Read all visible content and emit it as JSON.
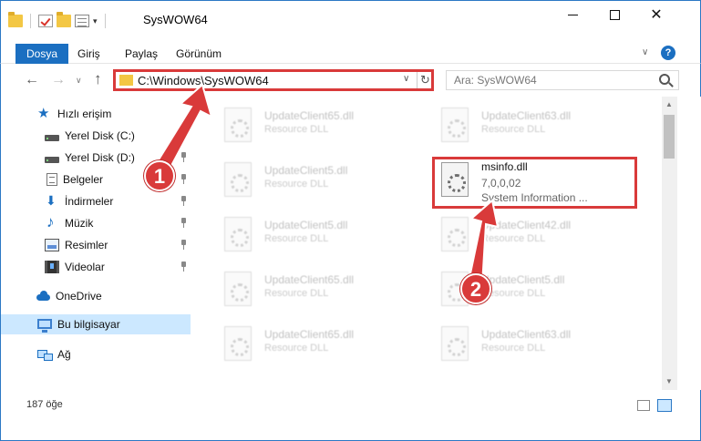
{
  "window": {
    "title": "SysWOW64"
  },
  "ribbon": {
    "tabs": [
      "Dosya",
      "Giriş",
      "Paylaş",
      "Görünüm"
    ]
  },
  "address": {
    "path": "C:\\Windows\\SysWOW64",
    "search_placeholder": "Ara: SysWOW64"
  },
  "sidebar": {
    "items": [
      {
        "label": "Hızlı erişim",
        "icon": "star-icon"
      },
      {
        "label": "Yerel Disk (C:)",
        "icon": "disk-icon"
      },
      {
        "label": "Yerel Disk (D:)",
        "icon": "disk-icon"
      },
      {
        "label": "Belgeler",
        "icon": "documents-icon"
      },
      {
        "label": "İndirmeler",
        "icon": "downloads-icon"
      },
      {
        "label": "Müzik",
        "icon": "music-icon"
      },
      {
        "label": "Resimler",
        "icon": "pictures-icon"
      },
      {
        "label": "Videolar",
        "icon": "videos-icon"
      },
      {
        "label": "OneDrive",
        "icon": "cloud-icon"
      },
      {
        "label": "Bu bilgisayar",
        "icon": "computer-icon"
      },
      {
        "label": "Ağ",
        "icon": "network-icon"
      }
    ]
  },
  "files": [
    {
      "name": "UpdateClient65.dll",
      "desc": "Resource DLL"
    },
    {
      "name": "UpdateClient63.dll",
      "desc": "Resource DLL"
    },
    {
      "name": "UpdateClient5.dll",
      "desc": "Resource DLL"
    },
    {
      "name": "msinfo.dll",
      "version": "7,0,0,02",
      "desc": "System Information ..."
    },
    {
      "name": "UpdateClient5.dll",
      "desc": "Resource DLL"
    },
    {
      "name": "UpdateClient42.dll",
      "desc": "Resource DLL"
    },
    {
      "name": "UpdateClient65.dll",
      "desc": "Resource DLL"
    },
    {
      "name": "UpdateClient5.dll",
      "desc": "Resource DLL"
    },
    {
      "name": "UpdateClient65.dll",
      "desc": "Resource DLL"
    },
    {
      "name": "UpdateClient63.dll",
      "desc": "Resource DLL"
    }
  ],
  "status": {
    "item_count": "187 öğe"
  },
  "callouts": [
    "1",
    "2"
  ],
  "colors": {
    "accent": "#1b6fc1",
    "annotation": "#d93a3a",
    "selected_nav": "#cce8ff"
  }
}
